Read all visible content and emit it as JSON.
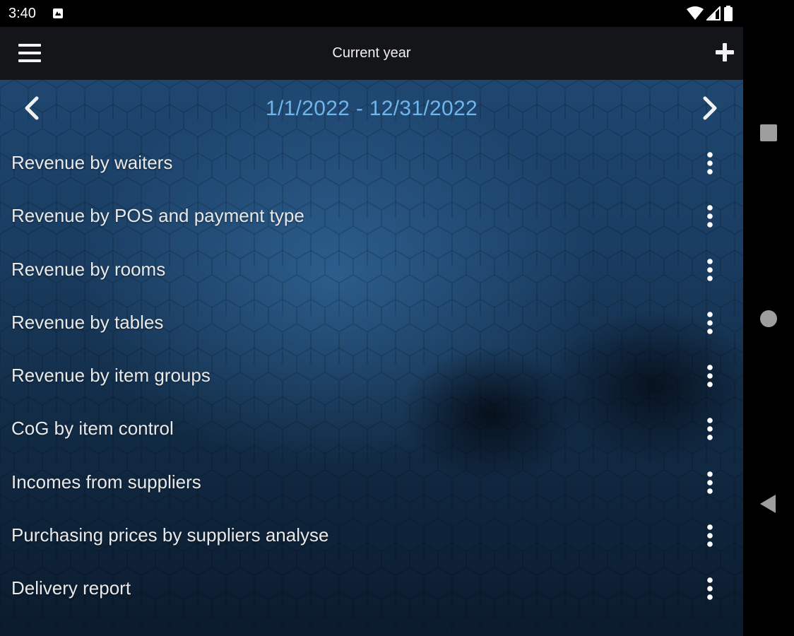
{
  "status_bar": {
    "time": "3:40"
  },
  "toolbar": {
    "title": "Current year",
    "menu_icon": "hamburger-menu-icon",
    "add_icon": "plus-icon"
  },
  "date_nav": {
    "range": "1/1/2022 - 12/31/2022",
    "prev_icon": "chevron-left-icon",
    "next_icon": "chevron-right-icon"
  },
  "reports": [
    {
      "label": "Revenue by waiters"
    },
    {
      "label": "Revenue by POS and payment type"
    },
    {
      "label": "Revenue by rooms"
    },
    {
      "label": "Revenue by tables"
    },
    {
      "label": "Revenue by item groups"
    },
    {
      "label": "CoG by item control"
    },
    {
      "label": "Incomes from suppliers"
    },
    {
      "label": "Purchasing prices by suppliers analyse"
    },
    {
      "label": "Delivery report"
    }
  ],
  "colors": {
    "accent": "#6fb4ea",
    "toolbar_bg": "#141518",
    "text": "#e9e9e9"
  }
}
